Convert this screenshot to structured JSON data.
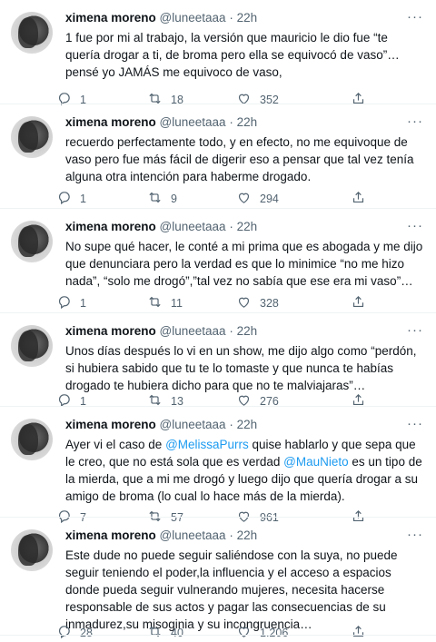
{
  "tweets": [
    {
      "name": "ximena moreno",
      "handle": "@luneetaaa",
      "time": "· 22h",
      "text": [
        {
          "t": "1 fue por mi al trabajo, la versión que mauricio le dio fue “te quería drogar a ti, de broma pero ella se equivocó de vaso”… pensé  yo JAMÁS me equivoco de vaso,"
        }
      ],
      "replies": "1",
      "retweets": "18",
      "likes": "352"
    },
    {
      "name": "ximena moreno",
      "handle": "@luneetaaa",
      "time": "· 22h",
      "text": [
        {
          "t": "recuerdo perfectamente todo, y en efecto, no me equivoque de vaso pero fue más fácil de digerir eso a pensar que tal vez tenía alguna otra intención para haberme drogado."
        }
      ],
      "replies": "1",
      "retweets": "9",
      "likes": "294"
    },
    {
      "name": "ximena moreno",
      "handle": "@luneetaaa",
      "time": "· 22h",
      "text": [
        {
          "t": "No supe qué hacer, le conté a mi prima que es abogada y me dijo que denunciara pero la verdad es que lo minimice “no me hizo nada”, “solo me drogó”,”tal vez no sabía que ese era mi vaso”…"
        }
      ],
      "replies": "1",
      "retweets": "11",
      "likes": "328"
    },
    {
      "name": "ximena moreno",
      "handle": "@luneetaaa",
      "time": "· 22h",
      "text": [
        {
          "t": "Unos días después lo vi en un show, me dijo algo como “perdón, si hubiera sabido que tu te lo tomaste y que nunca te habías drogado te hubiera dicho para que no te malviajaras”…"
        }
      ],
      "replies": "1",
      "retweets": "13",
      "likes": "276"
    },
    {
      "name": "ximena moreno",
      "handle": "@luneetaaa",
      "time": "· 22h",
      "text": [
        {
          "t": "Ayer  vi el caso de "
        },
        {
          "t": "@MelissaPurrs",
          "m": true
        },
        {
          "t": " quise hablarlo y que sepa que le creo, que no está sola  que es verdad "
        },
        {
          "t": "@MauNieto",
          "m": true
        },
        {
          "t": " es un tipo de la mierda, que  a mi me drogó y luego dijo que quería drogar a su amigo de broma (lo cual lo hace más de la mierda)."
        }
      ],
      "replies": "7",
      "retweets": "57",
      "likes": "961"
    },
    {
      "name": "ximena moreno",
      "handle": "@luneetaaa",
      "time": "· 22h",
      "text": [
        {
          "t": "Este dude no puede seguir saliéndose con la suya, no puede seguir teniendo el poder,la influencia y el acceso a espacios donde pueda seguir vulnerando mujeres, necesita hacerse responsable de sus actos y pagar las consecuencias de su inmadurez,su misoginia y su incongruencia…"
        }
      ],
      "replies": "28",
      "retweets": "40",
      "likes": "1.206"
    }
  ],
  "icons": {
    "more": "more-icon",
    "reply": "reply-icon",
    "retweet": "retweet-icon",
    "like": "heart-icon",
    "share": "share-icon"
  },
  "colors": {
    "mention": "#1d9bf0",
    "secondary": "#536471",
    "text": "#0f1419"
  }
}
